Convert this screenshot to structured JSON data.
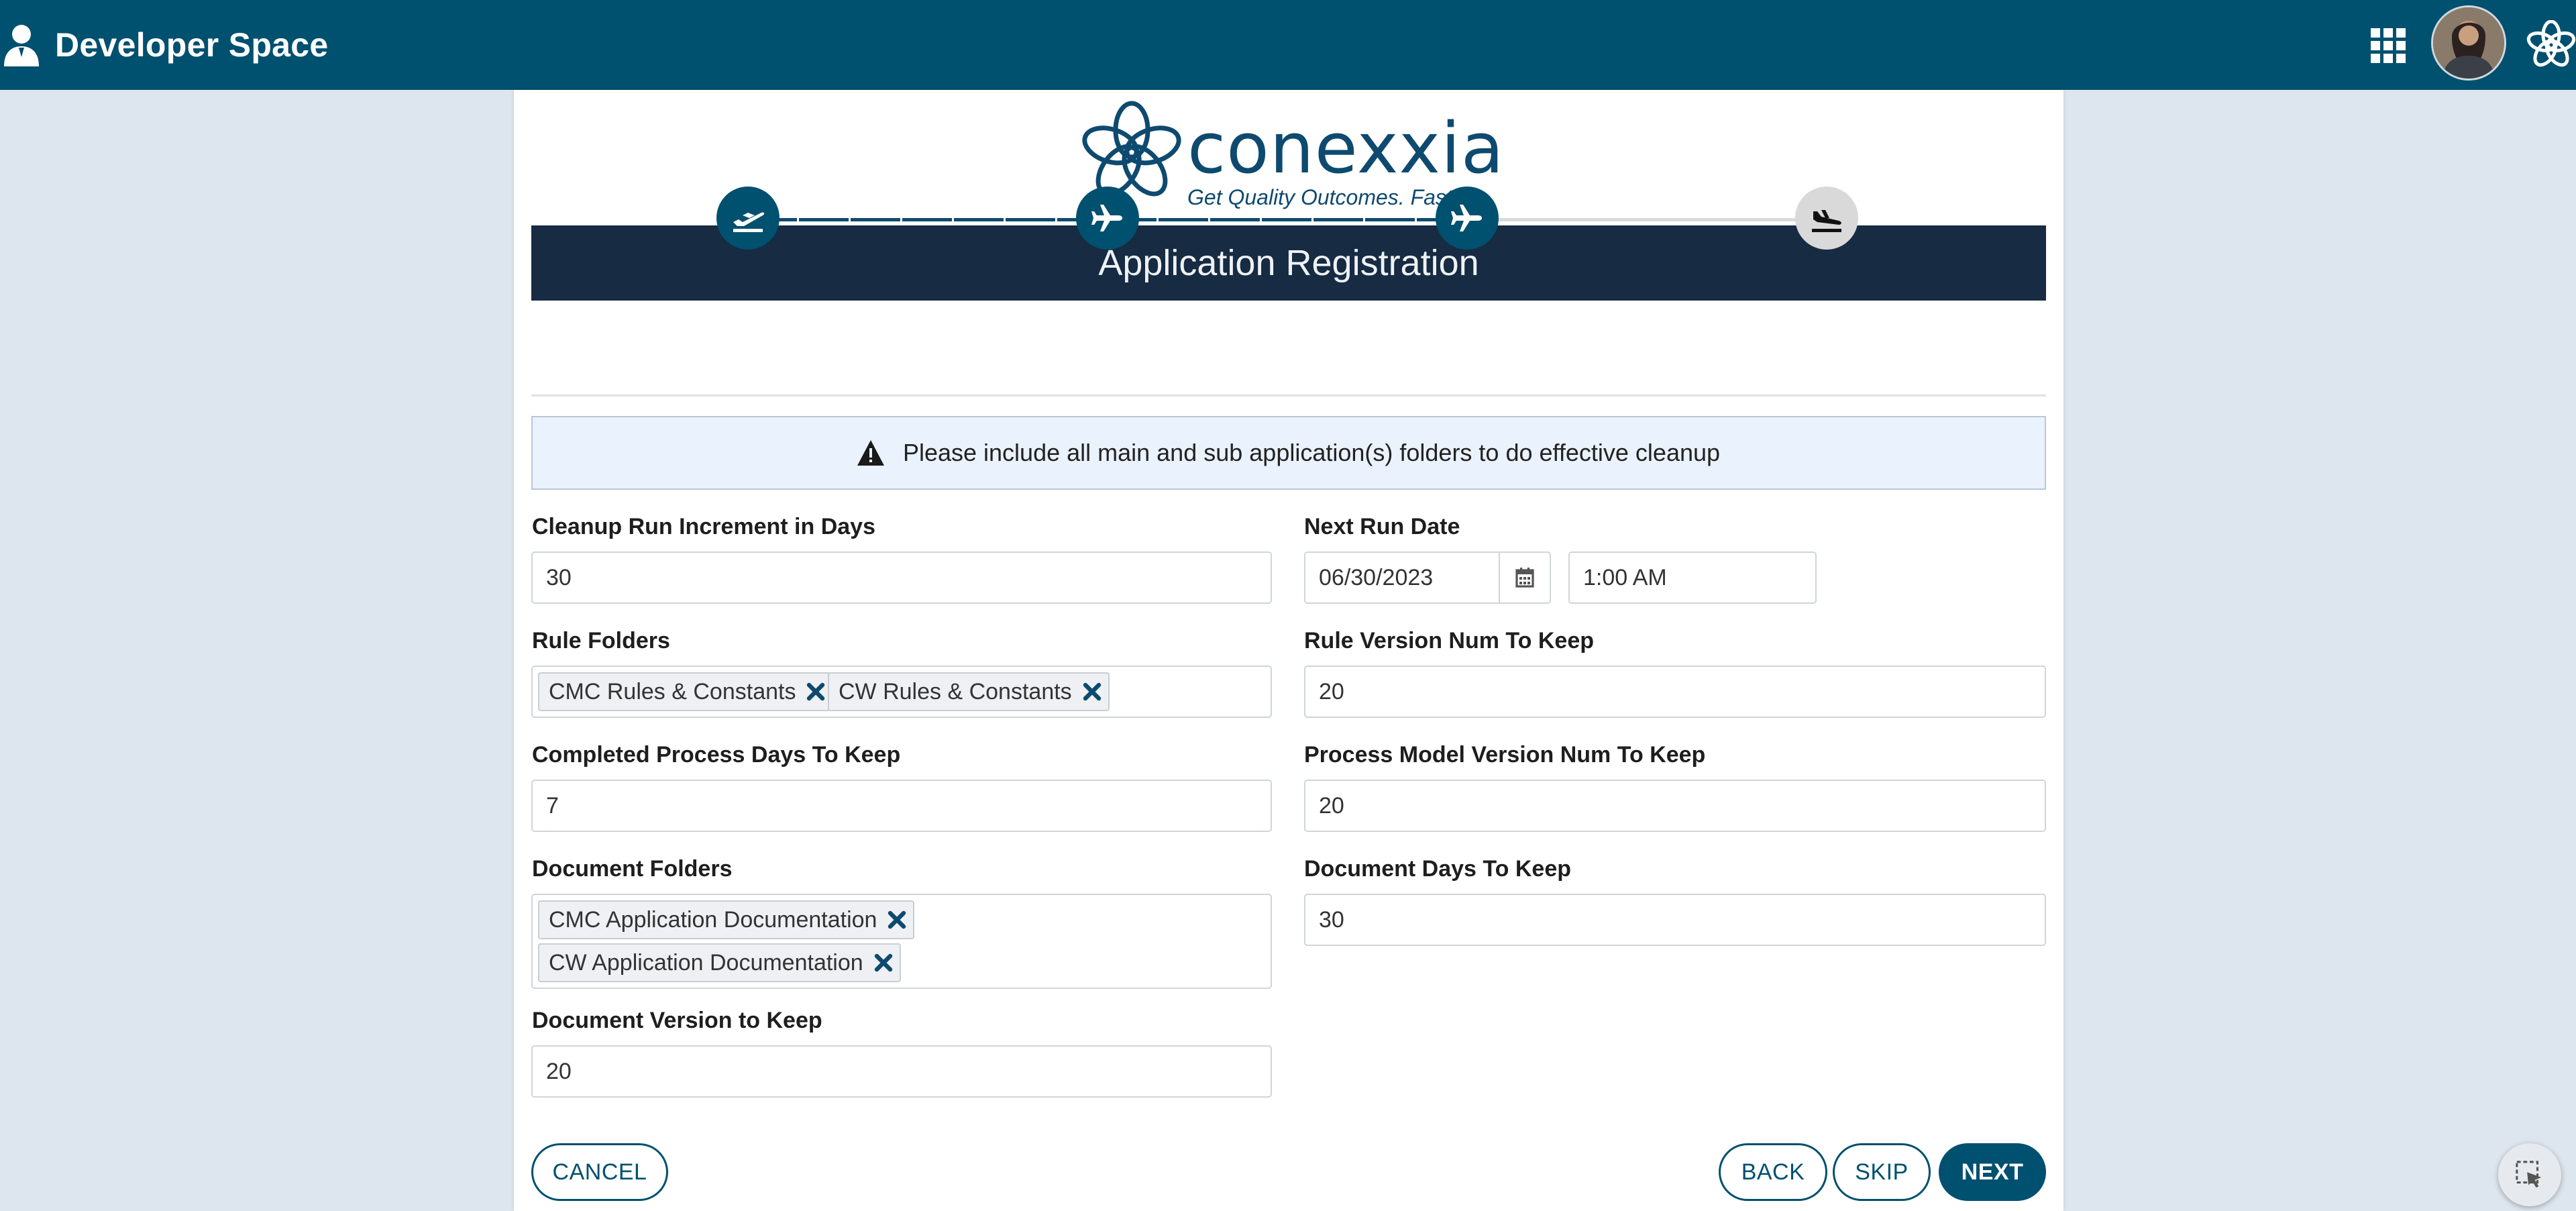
{
  "header": {
    "title": "Developer Space"
  },
  "logo": {
    "wordmark": "conexxia",
    "tagline": "Get Quality Outcomes. Faster."
  },
  "page": {
    "title": "Application Registration"
  },
  "stepper": {
    "current_step": 3,
    "total_steps": 4
  },
  "alert": {
    "text": "Please include all main and sub application(s) folders to do effective cleanup"
  },
  "form": {
    "cleanup_run_increment": {
      "label": "Cleanup Run Increment in Days",
      "value": "30"
    },
    "next_run_date": {
      "label": "Next Run Date",
      "date": "06/30/2023",
      "time": "1:00 AM"
    },
    "rule_folders": {
      "label": "Rule Folders",
      "chips": [
        "CMC Rules & Constants",
        "CW Rules & Constants"
      ]
    },
    "rule_version_num": {
      "label": "Rule Version Num To Keep",
      "value": "20"
    },
    "completed_process_days": {
      "label": "Completed Process Days To Keep",
      "value": "7"
    },
    "process_model_version_num": {
      "label": "Process Model Version Num To Keep",
      "value": "20"
    },
    "document_folders": {
      "label": "Document Folders",
      "chips": [
        "CMC Application Documentation",
        "CW Application Documentation"
      ]
    },
    "document_days": {
      "label": "Document Days To Keep",
      "value": "30"
    },
    "document_version": {
      "label": "Document Version to Keep",
      "value": "20"
    }
  },
  "buttons": {
    "cancel": "CANCEL",
    "back": "BACK",
    "skip": "SKIP",
    "next": "NEXT"
  },
  "colors": {
    "primary": "#00506f",
    "header_dark": "#172b42",
    "alert_bg": "#eaf2fd",
    "step_inactive": "#d9d9d9"
  },
  "icons": [
    "user-icon",
    "apps-grid-icon",
    "avatar",
    "swirl-logo-icon",
    "plane-takeoff-icon",
    "plane-icon",
    "plane-landing-icon",
    "warning-icon",
    "calendar-icon",
    "remove-chip-icon",
    "feedback-cursor-icon"
  ]
}
